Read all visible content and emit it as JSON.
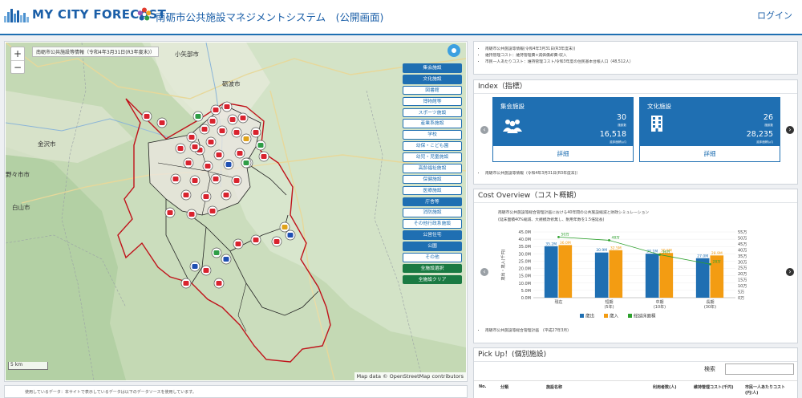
{
  "header": {
    "brand": "MY CITY FORECAST",
    "system_title": "南砺市公共施設マネジメントシステム　(公開画面)",
    "login_label": "ログイン"
  },
  "map": {
    "zoom_in": "+",
    "zoom_out": "−",
    "info": "南砺市公共施設等情報（令和4年3月31日(R3年度末)）",
    "scale": "5 km",
    "attribution": "Map data © OpenStreetMap contributors",
    "place_labels": [
      "小矢部市",
      "砺波市",
      "金沢市",
      "野々市市",
      "白山市"
    ],
    "categories": [
      {
        "label": "集会施設",
        "style": "on"
      },
      {
        "label": "文化施設",
        "style": "on"
      },
      {
        "label": "図書館",
        "style": "off"
      },
      {
        "label": "博物館等",
        "style": "off"
      },
      {
        "label": "スポーツ施設",
        "style": "off"
      },
      {
        "label": "産業系施設",
        "style": "off"
      },
      {
        "label": "学校",
        "style": "off"
      },
      {
        "label": "幼保・こども園",
        "style": "off"
      },
      {
        "label": "幼児・児童施設",
        "style": "off"
      },
      {
        "label": "高齢福祉施設",
        "style": "off"
      },
      {
        "label": "保健施設",
        "style": "off"
      },
      {
        "label": "医療施設",
        "style": "off"
      },
      {
        "label": "庁舎等",
        "style": "on"
      },
      {
        "label": "消防施設",
        "style": "off"
      },
      {
        "label": "その他行政系施設",
        "style": "off"
      },
      {
        "label": "公営住宅",
        "style": "on"
      },
      {
        "label": "公園",
        "style": "on"
      },
      {
        "label": "その他",
        "style": "off"
      },
      {
        "label": "全施設選択",
        "style": "green"
      },
      {
        "label": "全施設クリア",
        "style": "green"
      }
    ]
  },
  "summary_notes": [
    "南砺市公共施設等情報(令和4年3月31日(R3年度末))",
    "維持管理コスト：維持管理費+減価償却費-収入",
    "市民一人あたりコスト：維持管理コスト/令和3年度の住民基本台帳人口（48,512人）"
  ],
  "index": {
    "title": "Index（指標）",
    "cards": [
      {
        "title": "集会施設",
        "count": "30",
        "count_label": "施設数",
        "area": "16,518",
        "area_label": "延床面積(㎡)",
        "detail": "詳細",
        "icon": "people-icon"
      },
      {
        "title": "文化施設",
        "count": "26",
        "count_label": "施設数",
        "area": "28,235",
        "area_label": "延床面積(㎡)",
        "detail": "詳細",
        "icon": "building-icon"
      }
    ],
    "note": "南砺市公共施設等情報（令和4年3月31日(R3年度末)）"
  },
  "cost": {
    "title": "Cost Overview（コスト概観）",
    "desc1": "南砺市公共施設等総合管理計画における40年間の公共施設縮減と財政シミュレーション",
    "desc2": "(延床面積40%縮減、大規模改修無し、耐用年数を1.5倍延長)",
    "note": "南砺市公共施設等総合管理計画　(平成27年3月)"
  },
  "pickup": {
    "title": "Pick Up！(個別施設)",
    "search_label": "検索",
    "columns": [
      "No.",
      "分類",
      "施設名称",
      "利用者数(人)",
      "維持管理コスト(千円)",
      "市民一人あたりコスト(円/人)"
    ]
  },
  "footer_note": "使用しているデータ：本サイトで表示しているデータは以下のデータソースを使用しています。",
  "chart_data": {
    "type": "bar",
    "categories": [
      "現在",
      "短期\n(5年)",
      "中期\n(10年)",
      "長期\n(30年)"
    ],
    "category_labels": [
      "現在",
      "短期",
      "中期",
      "長期"
    ],
    "category_sub": [
      "",
      "(5年)",
      "(10年)",
      "(30年)"
    ],
    "series": [
      {
        "name": "歳出",
        "type": "bar",
        "color": "#1f6fb2",
        "values": [
          35.2,
          30.9,
          30.1,
          27.0
        ]
      },
      {
        "name": "歳入",
        "type": "bar",
        "color": "#f39c12",
        "values": [
          36.0,
          32.5,
          30.6,
          28.9
        ]
      },
      {
        "name": "総延床面積",
        "type": "line",
        "color": "#2ca02c",
        "values": [
          50.7,
          48.0,
          36.0,
          28.0
        ]
      }
    ],
    "data_labels": {
      "歳出": [
        "35.2M",
        "30.9M",
        "30.1M",
        "27.0M"
      ],
      "歳入": [
        "36.0M",
        "32.5M",
        "30.6M",
        "28.9M"
      ],
      "総延床面積": [
        "50万",
        "48万",
        "36万",
        "28万"
      ]
    },
    "ylabel_left": "歳出・歳入(千円)",
    "ylabel_right": "延床面積(㎡)",
    "ylim": [
      0,
      45
    ],
    "yticks": [
      "0.0M",
      "5.0M",
      "10.0M",
      "15.0M",
      "20.0M",
      "25.0M",
      "30.0M",
      "35.0M",
      "40.0M",
      "45.0M"
    ],
    "y2lim": [
      0,
      55
    ],
    "y2ticks": [
      "0万",
      "5万",
      "10万",
      "15万",
      "20万",
      "25万",
      "30万",
      "35万",
      "40万",
      "45万",
      "50万",
      "55万"
    ],
    "legend": "bottom"
  }
}
